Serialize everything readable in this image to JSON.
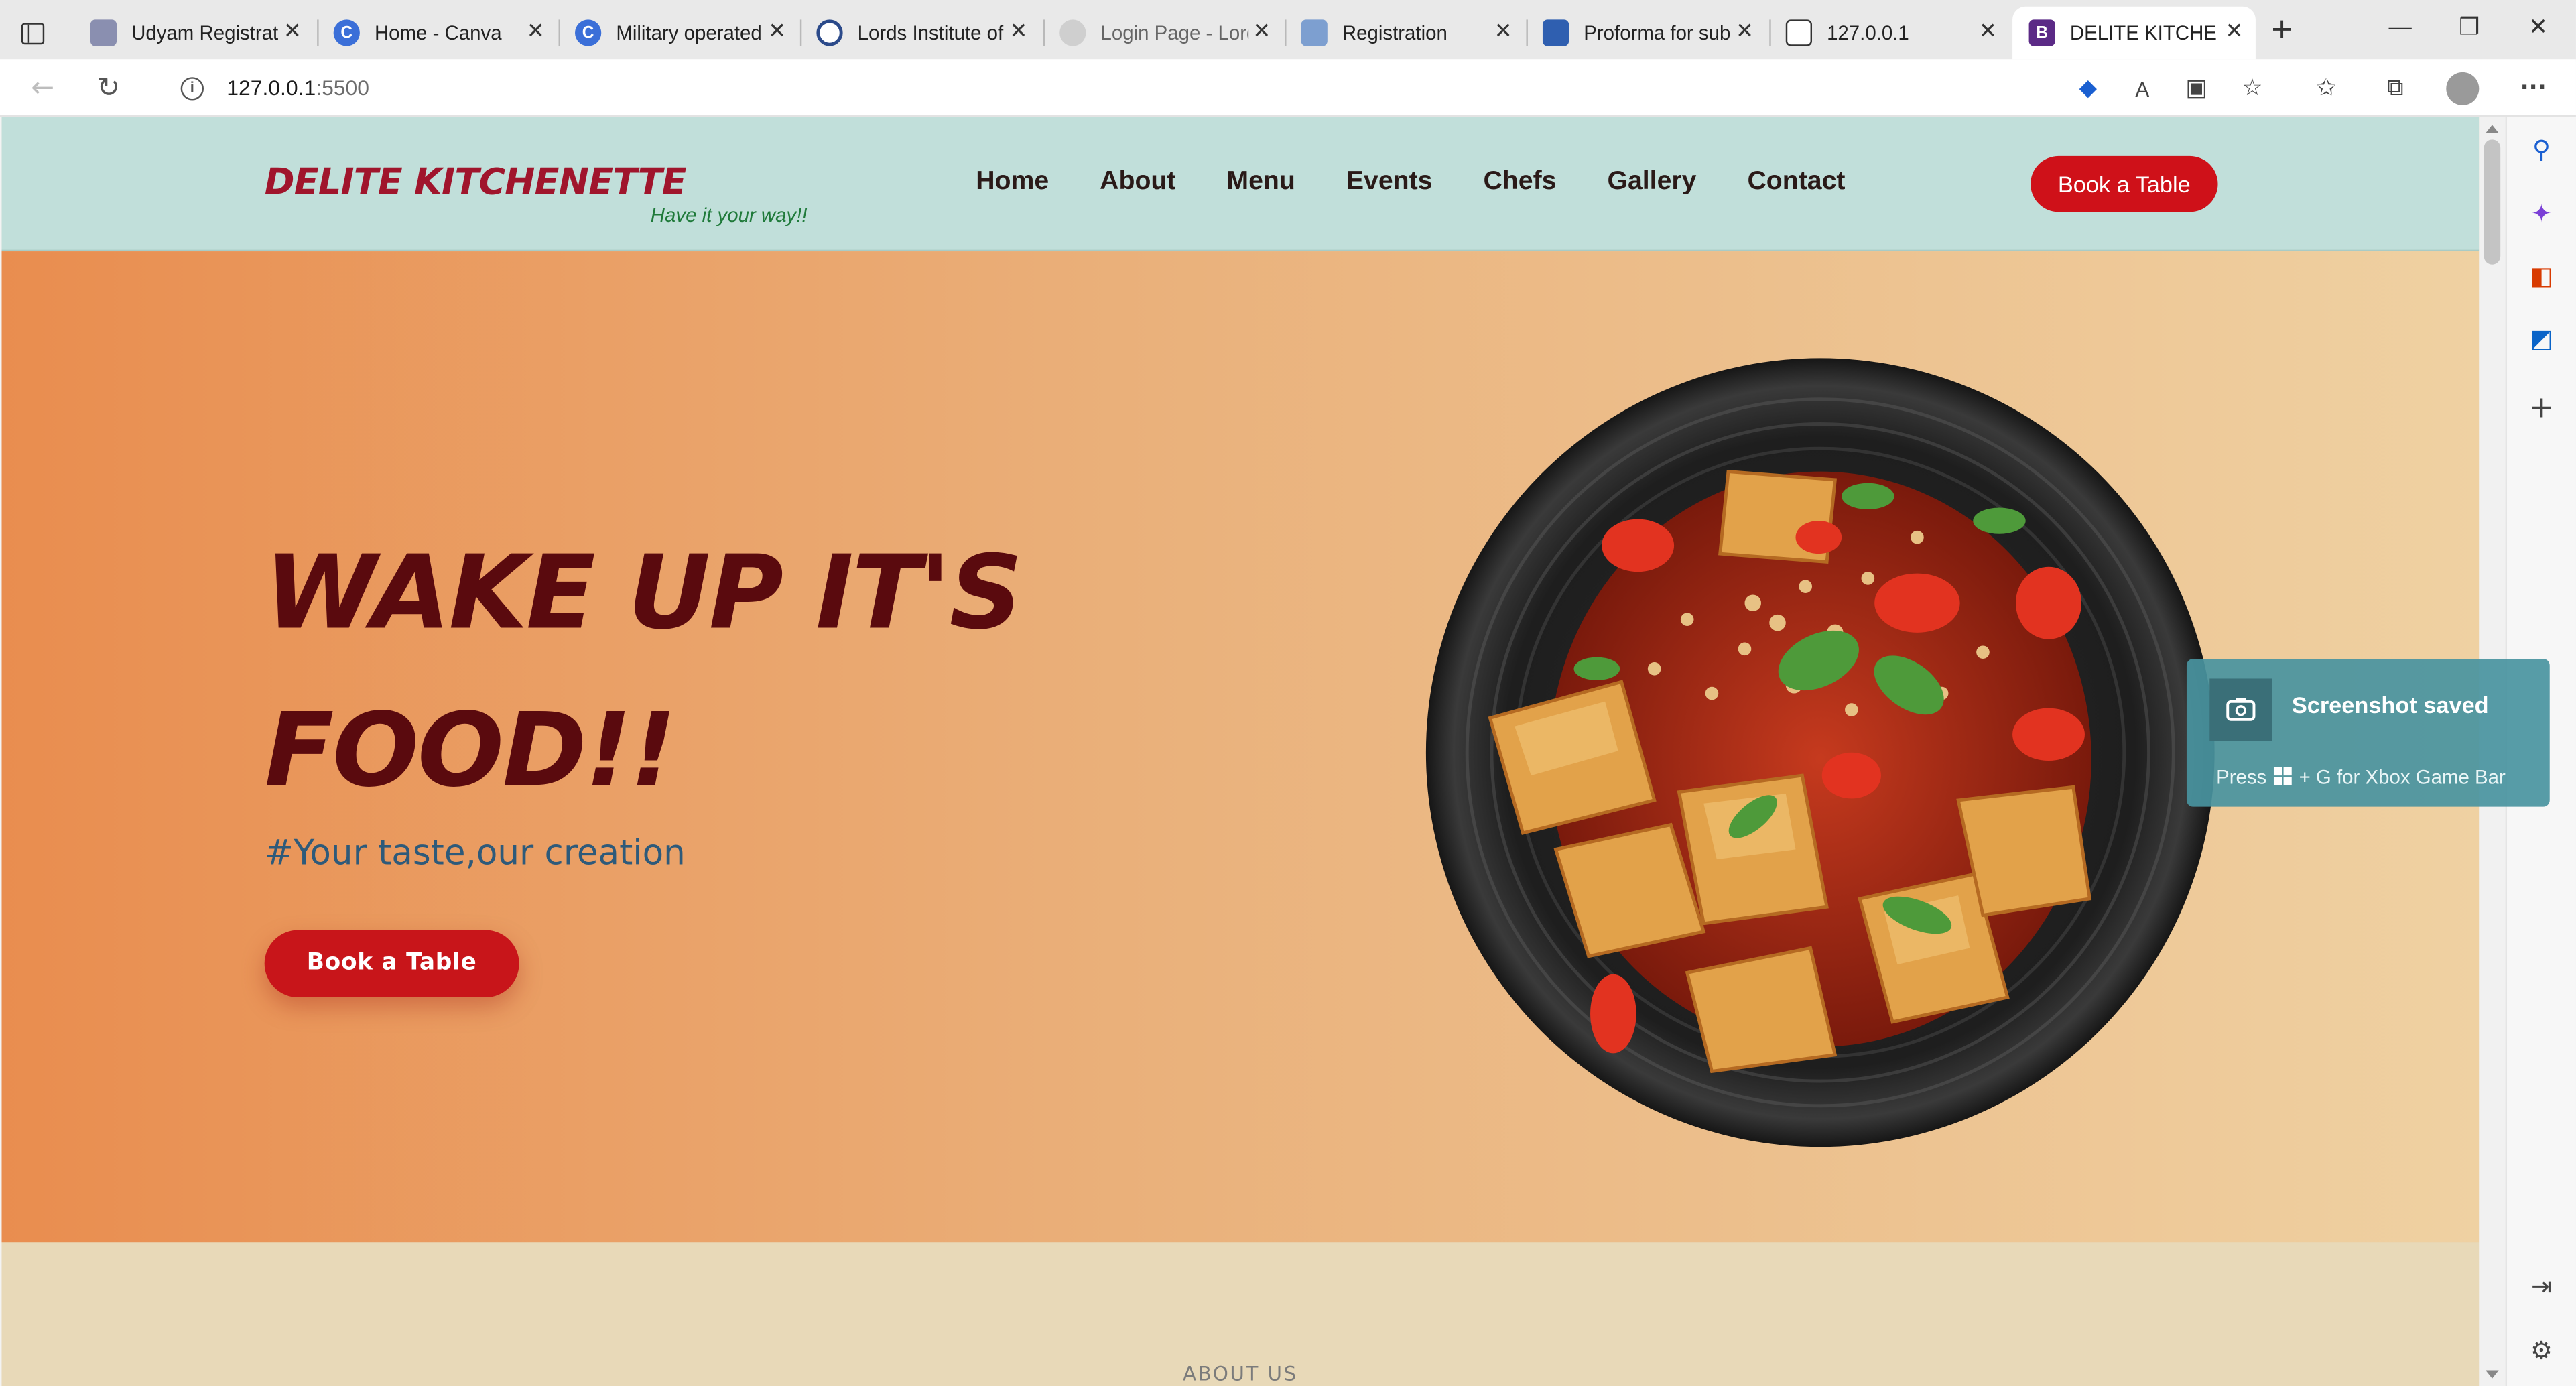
{
  "browser": {
    "tabs": [
      {
        "title": "Udyam Registratic",
        "favicon": "udyam-favicon",
        "color": "#8a8fb0"
      },
      {
        "title": "Home - Canva",
        "favicon": "canva-favicon",
        "color": "#3b6fd8"
      },
      {
        "title": "Military operated",
        "favicon": "canva-favicon",
        "color": "#3b6fd8"
      },
      {
        "title": "Lords Institute of",
        "favicon": "lords-favicon",
        "color": "#2b4a8a"
      },
      {
        "title": "Login Page - Lord",
        "favicon": "lords-favicon",
        "color": "#9a9a9a"
      },
      {
        "title": "Registration",
        "favicon": "form-favicon",
        "color": "#7d9fd0"
      },
      {
        "title": "Proforma for sub",
        "favicon": "form-favicon",
        "color": "#2f5fb0"
      },
      {
        "title": "127.0.0.1",
        "favicon": "page-favicon",
        "color": "#333333"
      },
      {
        "title": "DELITE KITCHENE",
        "favicon": "bootstrap-favicon",
        "color": "#5b2a86",
        "letter": "B",
        "active": true
      }
    ],
    "address": {
      "host": "127.0.0.1",
      "port": ":5500"
    }
  },
  "site": {
    "logo": "DELITE KITCHENETTE",
    "tagline": "Have it your way!!",
    "nav": [
      "Home",
      "About",
      "Menu",
      "Events",
      "Chefs",
      "Gallery",
      "Contact"
    ],
    "header_cta": "Book a Table",
    "hero": {
      "title_line1": "WAKE UP IT'S",
      "title_line2": "FOOD!!",
      "subtitle": "#Your taste,our creation",
      "cta": "Book a Table"
    },
    "about_label": "ABOUT US"
  },
  "toast": {
    "title": "Screenshot saved",
    "body_prefix": "Press",
    "body_suffix": "+ G for Xbox Game Bar"
  },
  "colors": {
    "header_bg": "#c1dfda",
    "brand_red": "#a0152c",
    "button_red": "#cf1119",
    "hero_title": "#5a0a0e"
  }
}
